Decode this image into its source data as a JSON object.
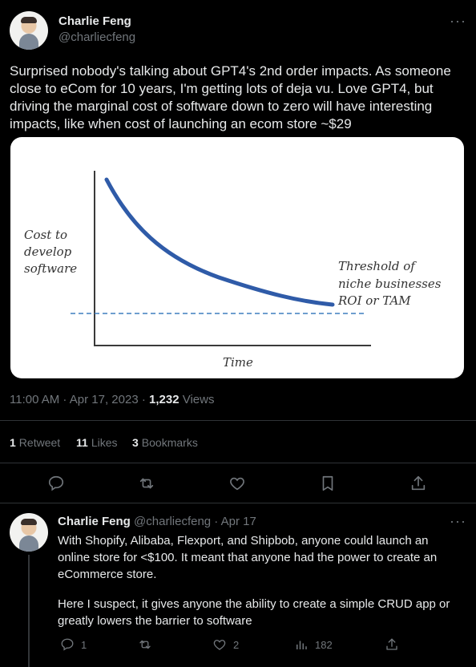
{
  "tweet": {
    "author_name": "Charlie Feng",
    "author_handle": "@charliecfeng",
    "text": "Surprised nobody's talking about GPT4's 2nd order impacts. As someone close to eCom for 10 years, I'm getting lots of deja vu. Love GPT4, but driving the marginal cost of software down to zero will have interesting impacts, like when cost of launching an ecom store ~$29",
    "timestamp": "11:00 AM · Apr 17, 2023 · ",
    "views_count": "1,232",
    "views_label": " Views",
    "stats": {
      "retweets_count": "1",
      "retweets_label": "Retweet",
      "likes_count": "11",
      "likes_label": "Likes",
      "bookmarks_count": "3",
      "bookmarks_label": "Bookmarks"
    }
  },
  "image": {
    "ylabel_line1": "Cost to",
    "ylabel_line2": "develop",
    "ylabel_line3": "software",
    "xlabel": "Time",
    "threshold_line1": "Threshold of",
    "threshold_line2": "niche businesses",
    "threshold_line3": "ROI or TAM",
    "curve_color": "#2f5ba8",
    "threshold_color": "#3f7fbf"
  },
  "reply": {
    "author_name": "Charlie Feng",
    "author_handle": "@charliecfeng · Apr 17",
    "paragraph1": "With Shopify, Alibaba, Flexport, and Shipbob, anyone could launch an online store for <$100. It meant that anyone had the power to create an eCommerce store.",
    "paragraph2": "Here I suspect, it gives anyone the ability to create a simple CRUD app or greatly lowers the barrier to software",
    "replies": "1",
    "likes": "2",
    "views": "182"
  },
  "more_glyph": "···"
}
